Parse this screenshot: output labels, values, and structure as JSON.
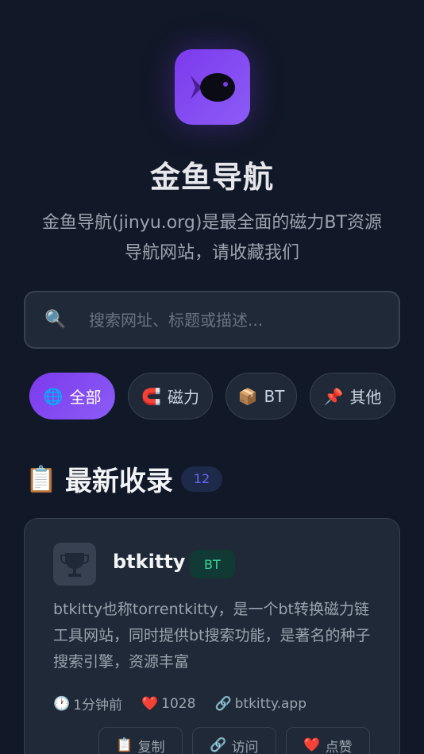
{
  "header": {
    "logo_icon": "fish-icon",
    "title": "金鱼导航",
    "description_line1": "金鱼导航(jinyu.org)是最全面的磁力BT资源",
    "description_line2": "导航网站，请收藏我们"
  },
  "search": {
    "icon": "🔍",
    "placeholder": "搜索网址、标题或描述..."
  },
  "filters": [
    {
      "icon": "🌐",
      "label": "全部",
      "active": true
    },
    {
      "icon": "🧲",
      "label": "磁力",
      "active": false
    },
    {
      "icon": "📦",
      "label": "BT",
      "active": false
    },
    {
      "icon": "📌",
      "label": "其他",
      "active": false
    }
  ],
  "section": {
    "icon": "📋",
    "title": "最新收录",
    "count": "12"
  },
  "card": {
    "logo_icon": "trophy-icon",
    "title": "btkitty",
    "tag": "BT",
    "description": "btkitty也称torrentkitty，是一个bt转换磁力链工具网站，同时提供bt搜索功能，是著名的种子搜索引擎，资源丰富",
    "time_icon": "🕐",
    "time": "1分钟前",
    "likes_icon": "❤️",
    "likes": "1028",
    "link_icon": "🔗",
    "domain": "btkitty.app",
    "actions": [
      {
        "icon": "📋",
        "label": "复制"
      },
      {
        "icon": "🔗",
        "label": "访问"
      },
      {
        "icon": "❤️",
        "label": "点赞"
      }
    ]
  },
  "colors": {
    "background": "#111827",
    "accent": "#7c3aed",
    "tag_green": "#34d399"
  }
}
